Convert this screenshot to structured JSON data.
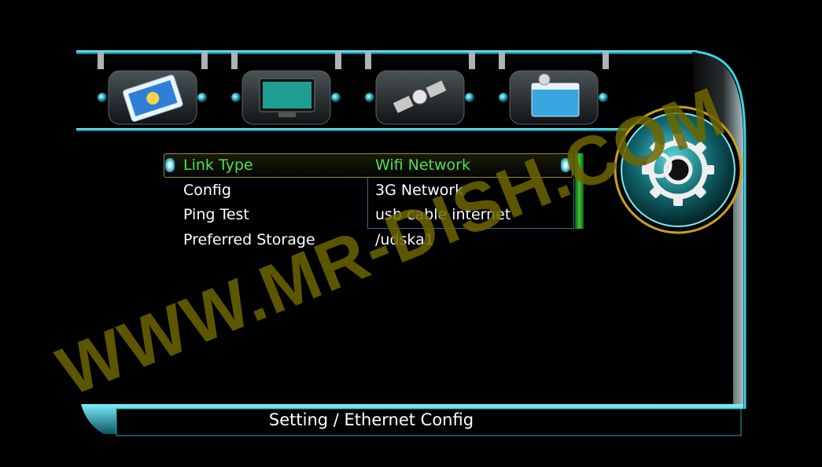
{
  "top_icons": [
    {
      "name": "settings-panel-icon"
    },
    {
      "name": "tv-monitor-icon"
    },
    {
      "name": "satellite-icon"
    },
    {
      "name": "media-window-icon"
    }
  ],
  "menu": {
    "items": [
      {
        "label": "Link Type",
        "value": "Wifi Network",
        "selected": true
      },
      {
        "label": "Config",
        "value": "3G Network"
      },
      {
        "label": "Ping Test",
        "value": "usb cable internet"
      },
      {
        "label": "Preferred Storage",
        "value": "/udska1"
      }
    ]
  },
  "status_bar": {
    "breadcrumb": "Setting / Ethernet Config"
  },
  "watermark": {
    "text": "WWW.MR-DISH.COM"
  },
  "colors": {
    "accent_cyan": "#2fd3e0",
    "selected_text": "#4fe04a",
    "watermark": "#6e6600",
    "gold_ring": "#c9a020"
  }
}
